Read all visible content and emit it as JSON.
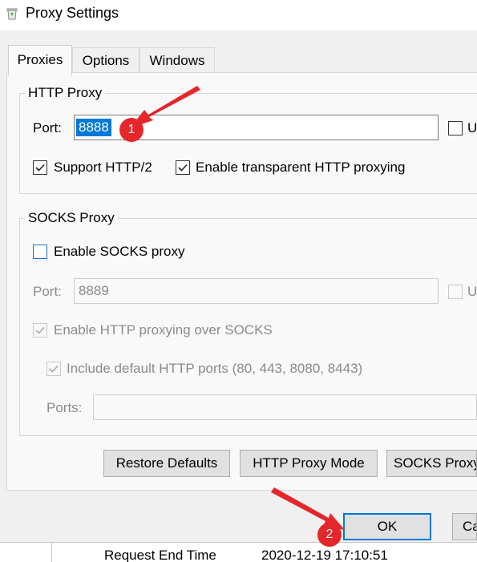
{
  "window": {
    "title": "Proxy Settings",
    "icon": "recycle-bin-icon"
  },
  "tabs": [
    {
      "label": "Proxies",
      "active": true
    },
    {
      "label": "Options",
      "active": false
    },
    {
      "label": "Windows",
      "active": false
    }
  ],
  "http_proxy": {
    "legend": "HTTP Proxy",
    "port_label": "Port:",
    "port_value": "8888",
    "port_value_selected": true,
    "right_checkbox_partial_label": "U",
    "support_http2": {
      "label": "Support HTTP/2",
      "checked": true
    },
    "transparent": {
      "label": "Enable transparent HTTP proxying",
      "checked": true
    }
  },
  "socks_proxy": {
    "legend": "SOCKS Proxy",
    "enable": {
      "label": "Enable SOCKS proxy",
      "checked": false
    },
    "port_label": "Port:",
    "port_value": "8889",
    "right_checkbox_partial_label": "U",
    "http_over_socks": {
      "label": "Enable HTTP proxying over SOCKS",
      "checked": true,
      "disabled": true
    },
    "include_default_ports": {
      "label": "Include default HTTP ports (80, 443, 8080, 8443)",
      "checked": true,
      "disabled": true
    },
    "ports_label": "Ports:",
    "ports_value": ""
  },
  "footer_buttons": {
    "restore_defaults": "Restore Defaults",
    "http_proxy_mode": "HTTP Proxy Mode",
    "socks_proxy": "SOCKS Proxy"
  },
  "dialog_buttons": {
    "ok": "OK",
    "cancel_partial": "Ca"
  },
  "annotations": [
    {
      "number": "1"
    },
    {
      "number": "2"
    }
  ],
  "background_peek": {
    "label": "Request End Time",
    "value": "2020-12-19 17:10:51"
  },
  "colors": {
    "selection": "#0078d7",
    "annotation_red": "#e5262a",
    "primary_button_border": "#0078d7"
  }
}
